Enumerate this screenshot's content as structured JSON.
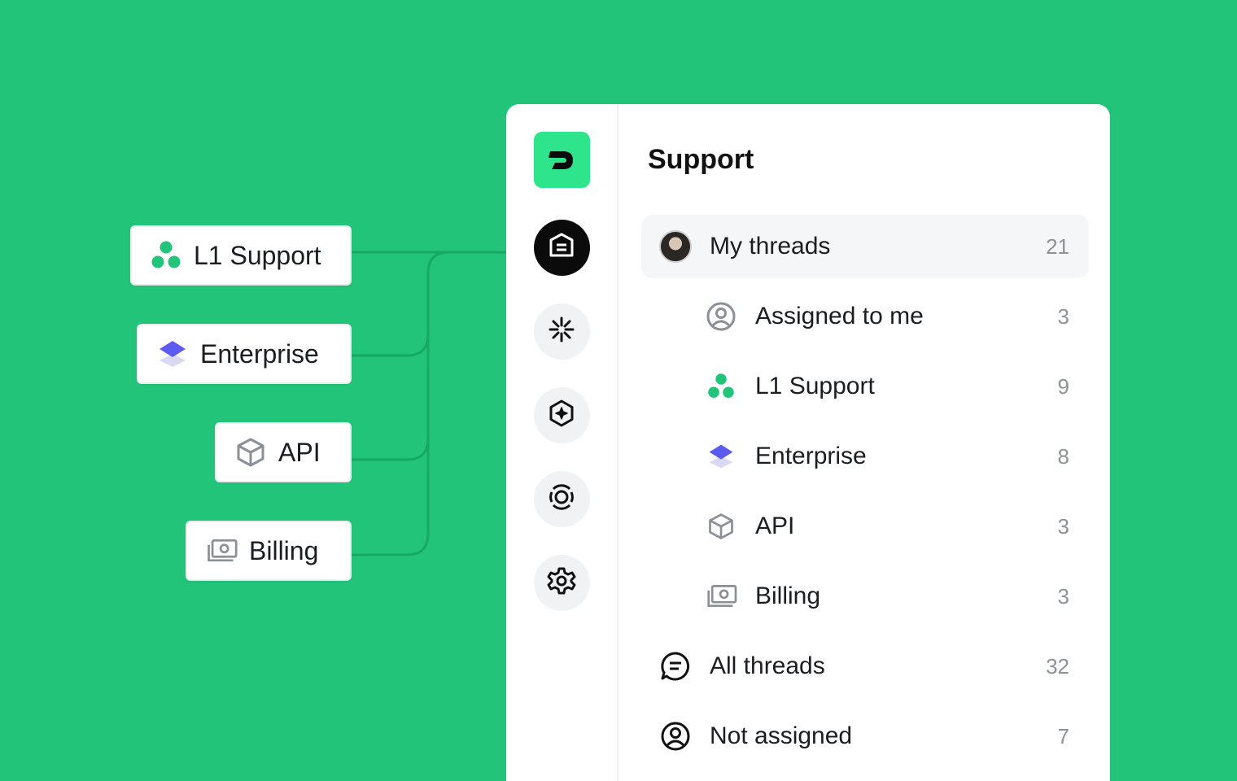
{
  "tags": [
    {
      "label": "L1 Support",
      "icon": "team-dots-icon"
    },
    {
      "label": "Enterprise",
      "icon": "layers-icon"
    },
    {
      "label": "API",
      "icon": "cube-icon"
    },
    {
      "label": "Billing",
      "icon": "money-icon"
    }
  ],
  "sidebar": {
    "logo": "app-logo",
    "buttons": [
      "threads-icon",
      "sparkle-icon",
      "hexagon-plus-icon",
      "target-icon",
      "gear-icon"
    ]
  },
  "panel": {
    "title": "Support",
    "items": [
      {
        "label": "My threads",
        "count": "21",
        "icon": "avatar",
        "selected": true
      },
      {
        "label": "Assigned to me",
        "count": "3",
        "icon": "user-circle-icon"
      },
      {
        "label": "L1 Support",
        "count": "9",
        "icon": "team-dots-icon"
      },
      {
        "label": "Enterprise",
        "count": "8",
        "icon": "layers-icon"
      },
      {
        "label": "API",
        "count": "3",
        "icon": "cube-icon"
      },
      {
        "label": "Billing",
        "count": "3",
        "icon": "money-icon"
      },
      {
        "label": "All threads",
        "count": "32",
        "icon": "chat-bubble-icon"
      },
      {
        "label": "Not assigned",
        "count": "7",
        "icon": "user-circle-icon"
      }
    ]
  },
  "colors": {
    "background": "#22c47a",
    "brand": "#2ee58b",
    "team": "#22c47a",
    "enterprise": "#5b5bf0"
  }
}
